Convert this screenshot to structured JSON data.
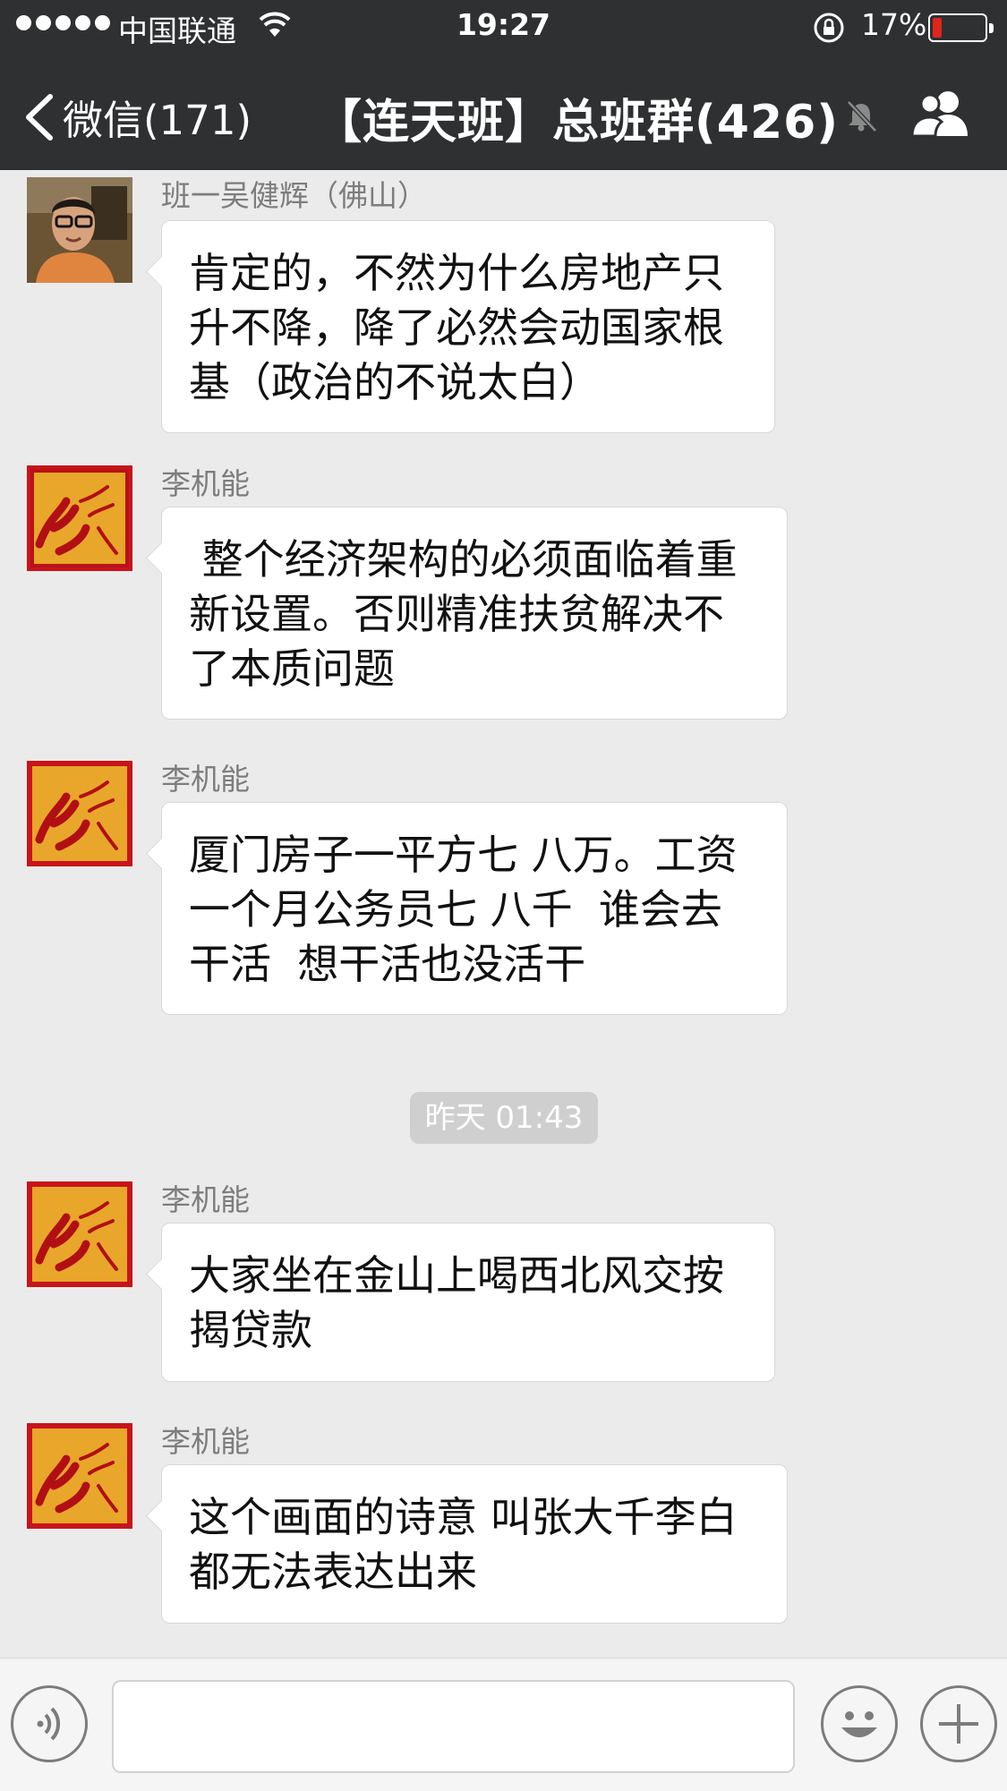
{
  "status_bar": {
    "carrier": "中国联通",
    "time": "19:27",
    "battery_percent": "17%",
    "battery_level": 0.17,
    "battery_color": "#e0261b"
  },
  "nav": {
    "back_label": "微信(171)",
    "title": "【连天班】总班群(426)",
    "icons": [
      "chevron-left-icon",
      "mute-bell-icon",
      "group-members-icon"
    ]
  },
  "messages": [
    {
      "sender": "班一吴健辉（佛山）",
      "avatar": "photo-avatar",
      "text": "肯定的，不然为什么房地产只\n升不降，降了必然会动国家根\n基（政治的不说太白）"
    },
    {
      "sender": "李机能",
      "avatar": "red-calligraphy-avatar",
      "text": " 整个经济架构的必须面临着重\n新设置。否则精准扶贫解决不\n了本质问题"
    },
    {
      "sender": "李机能",
      "avatar": "red-calligraphy-avatar",
      "text": "厦门房子一平方七 八万。工资\n一个月公务员七 八千  谁会去\n干活  想干活也没活干"
    },
    {
      "sender": "李机能",
      "avatar": "red-calligraphy-avatar",
      "text": "大家坐在金山上喝西北风交按\n揭贷款"
    },
    {
      "sender": "李机能",
      "avatar": "red-calligraphy-avatar",
      "text": "这个画面的诗意 叫张大千李白\n都无法表达出来"
    }
  ],
  "timestamp": "昨天 01:43",
  "input_bar": {
    "icons": [
      "voice-icon",
      "emoji-icon",
      "plus-icon"
    ],
    "placeholder": ""
  },
  "colors": {
    "nav_bg": "#2e3032",
    "chat_bg": "#ebebeb",
    "bubble_bg": "#ffffff",
    "avatar_red": "#c8141b",
    "avatar_gold": "#e8a62a"
  }
}
